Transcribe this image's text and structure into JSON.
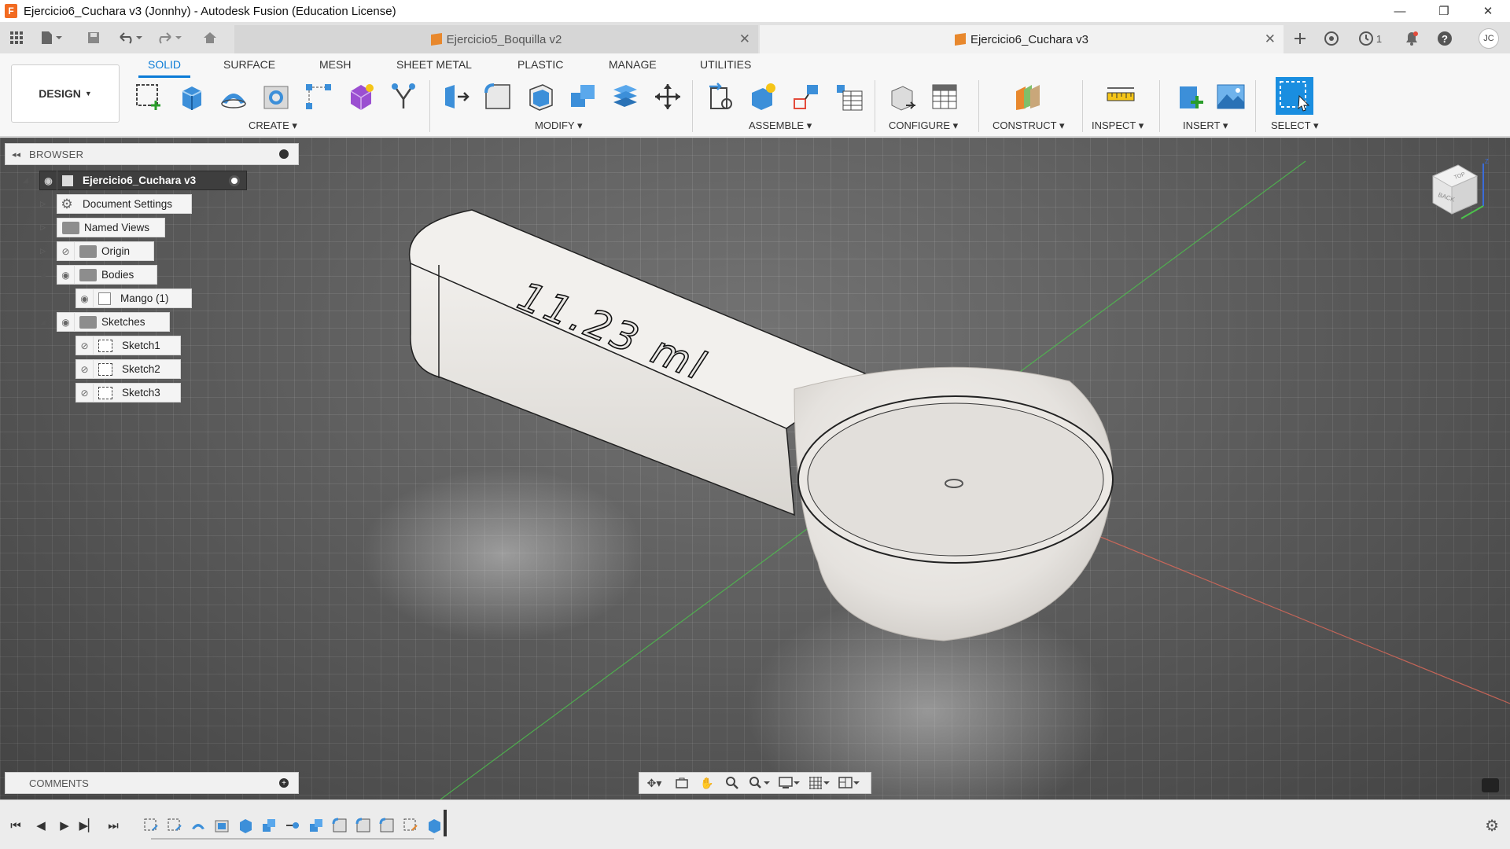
{
  "window": {
    "title": "Ejercicio6_Cuchara v3 (Jonnhy) - Autodesk Fusion (Education License)",
    "app_logo": "F",
    "min_glyph": "—",
    "max_glyph": "❐",
    "close_glyph": "✕"
  },
  "tabs": [
    {
      "label": "Ejercicio5_Boquilla v2",
      "active": false
    },
    {
      "label": "Ejercicio6_Cuchara v3",
      "active": true
    }
  ],
  "topbar": {
    "jobs_count": "1",
    "user_initials": "JC"
  },
  "ribbon": {
    "workspace": "DESIGN",
    "tabs": [
      "SOLID",
      "SURFACE",
      "MESH",
      "SHEET METAL",
      "PLASTIC",
      "MANAGE",
      "UTILITIES"
    ],
    "groups": [
      "CREATE",
      "MODIFY",
      "ASSEMBLE",
      "CONFIGURE",
      "CONSTRUCT",
      "INSPECT",
      "INSERT",
      "SELECT"
    ]
  },
  "browser": {
    "title": "BROWSER",
    "root": "Ejercicio6_Cuchara v3",
    "items": [
      {
        "label": "Document Settings"
      },
      {
        "label": "Named Views"
      },
      {
        "label": "Origin"
      },
      {
        "label": "Bodies"
      },
      {
        "label": "Mango (1)"
      },
      {
        "label": "Sketches"
      },
      {
        "label": "Sketch1"
      },
      {
        "label": "Sketch2"
      },
      {
        "label": "Sketch3"
      }
    ]
  },
  "comments": {
    "title": "COMMENTS"
  },
  "model": {
    "engraving": "11.23 ml"
  },
  "viewcube": {
    "face_top": "TOP",
    "face_back": "BACK",
    "axis_z": "Z"
  },
  "colors": {
    "accent": "#0a7bd6",
    "viewport": "#5a5a5a",
    "brand": "#f26b21"
  }
}
